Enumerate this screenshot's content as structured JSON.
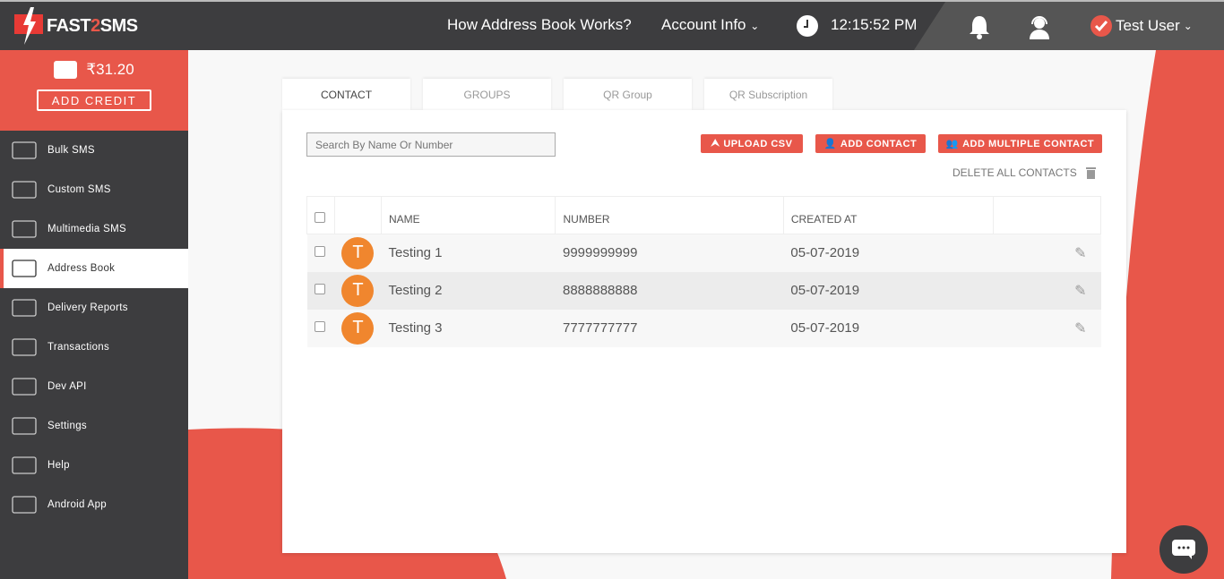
{
  "header": {
    "brand": "FAST2SMS",
    "brand_prefix": "FAST",
    "brand_mid": "2",
    "brand_suffix": "SMS",
    "how_it_works": "How Address Book Works?",
    "account_info": "Account Info",
    "time": "12:15:52 PM",
    "user": "Test User"
  },
  "sidebar": {
    "balance": "₹31.20",
    "add_credit": "ADD CREDIT",
    "items": [
      {
        "label": "Bulk SMS",
        "icon": "envelope-icon"
      },
      {
        "label": "Custom SMS",
        "icon": "envelope-gear-icon"
      },
      {
        "label": "Multimedia SMS",
        "icon": "envelope-plus-icon"
      },
      {
        "label": "Address Book",
        "icon": "address-book-icon",
        "active": true
      },
      {
        "label": "Delivery Reports",
        "icon": "chart-icon"
      },
      {
        "label": "Transactions",
        "icon": "monitor-money-icon"
      },
      {
        "label": "Dev API",
        "icon": "code-icon"
      },
      {
        "label": "Settings",
        "icon": "sliders-icon"
      },
      {
        "label": "Help",
        "icon": "question-icon"
      },
      {
        "label": "Android App",
        "icon": "android-icon"
      }
    ]
  },
  "tabs": [
    "CONTACT",
    "GROUPS",
    "QR Group",
    "QR Subscription"
  ],
  "search": {
    "placeholder": "Search By Name Or Number"
  },
  "actions": {
    "upload_csv": "UPLOAD CSV",
    "add_contact": "ADD CONTACT",
    "add_multiple": "ADD MULTIPLE CONTACT",
    "delete_all": "DELETE ALL CONTACTS"
  },
  "table": {
    "headers": [
      "NAME",
      "NUMBER",
      "CREATED AT"
    ],
    "rows": [
      {
        "initial": "T",
        "name": "Testing 1",
        "number": "9999999999",
        "created": "05-07-2019"
      },
      {
        "initial": "T",
        "name": "Testing 2",
        "number": "8888888888",
        "created": "05-07-2019"
      },
      {
        "initial": "T",
        "name": "Testing 3",
        "number": "7777777777",
        "created": "05-07-2019"
      }
    ]
  },
  "colors": {
    "accent": "#e8574a",
    "dark": "#3d3d3f",
    "avatar": "#f0862e"
  }
}
